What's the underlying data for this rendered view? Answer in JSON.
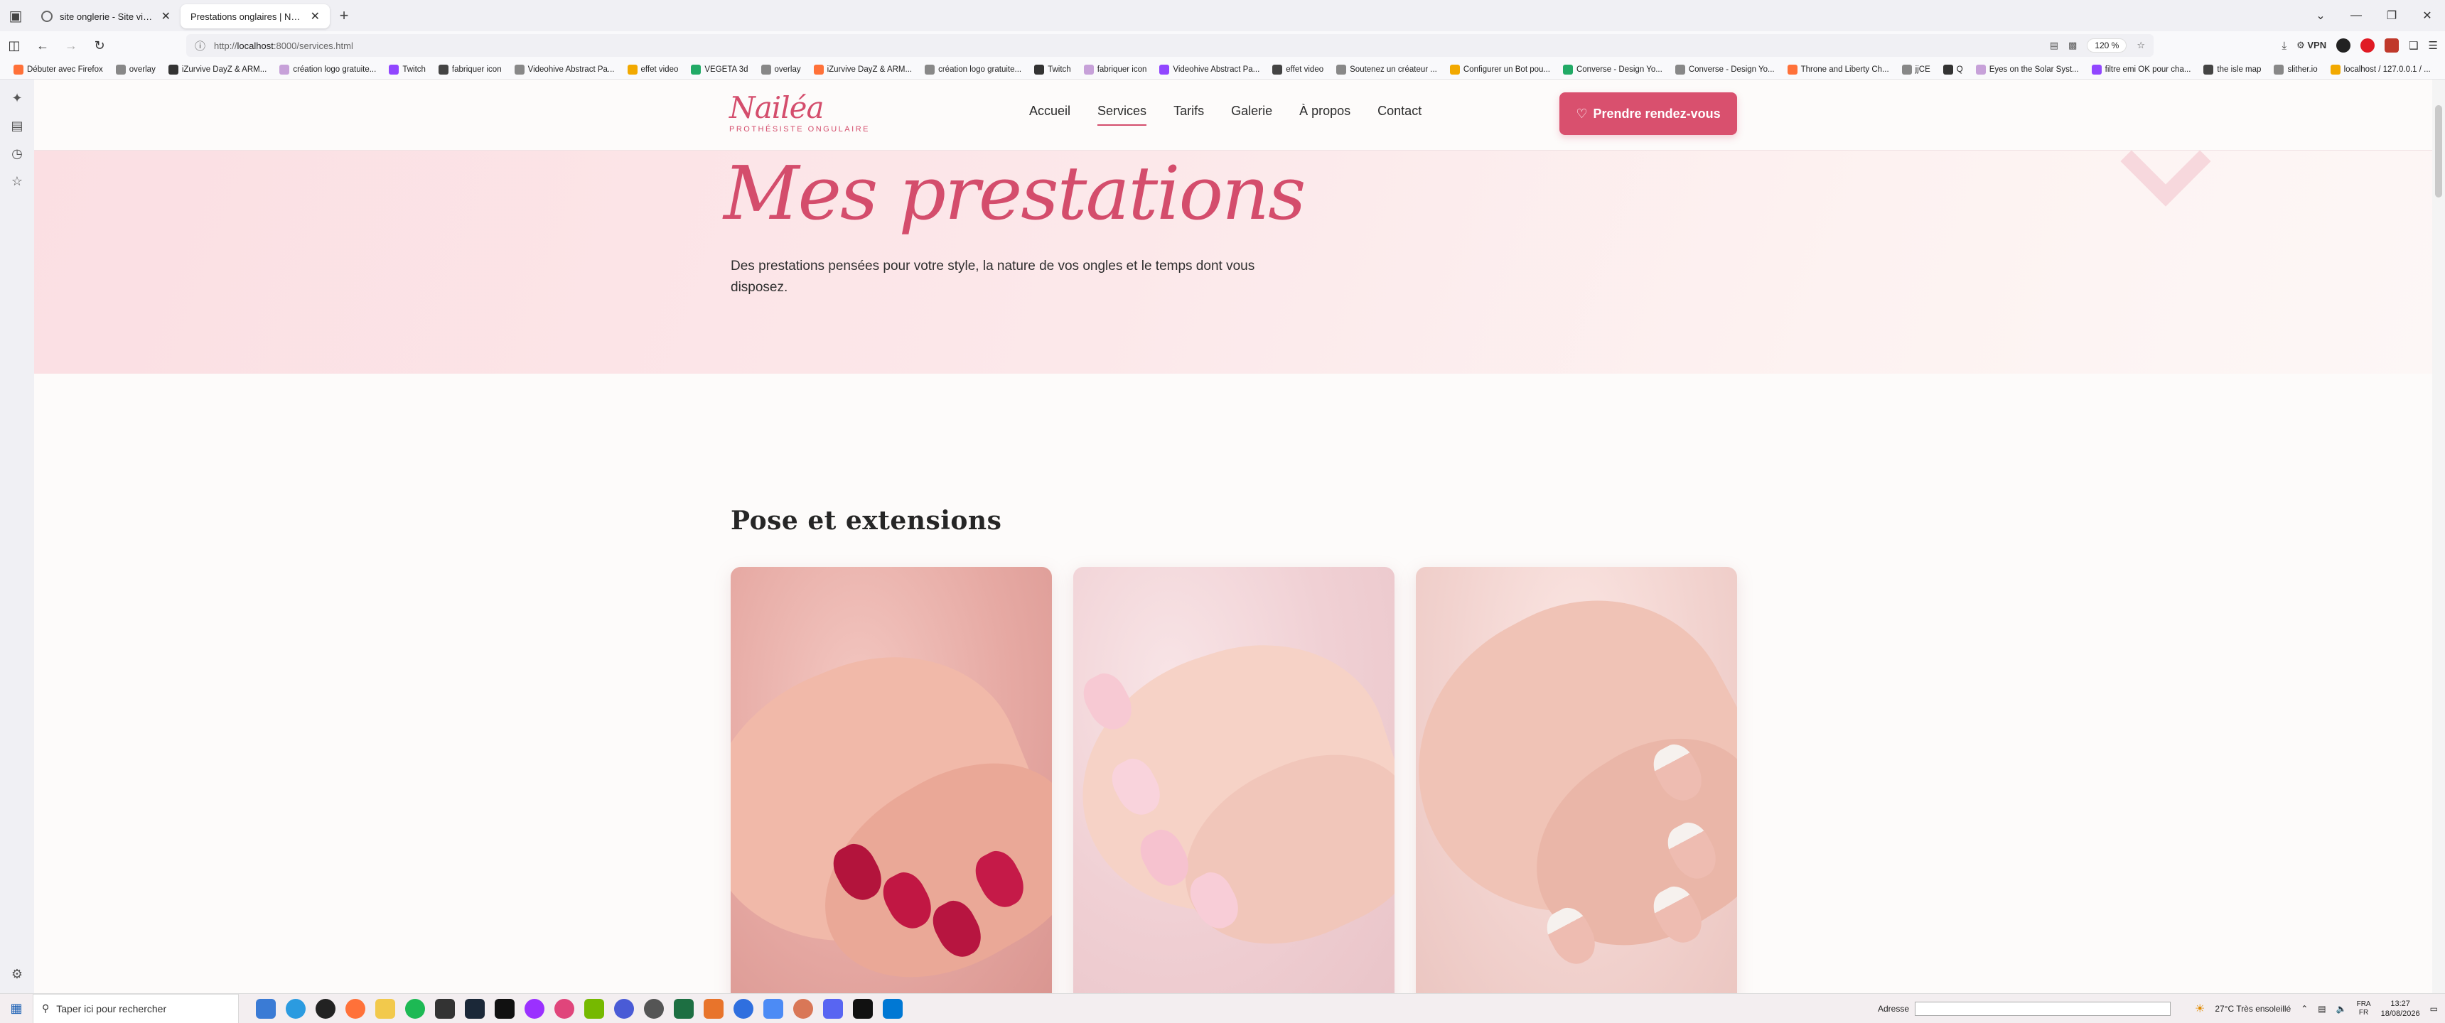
{
  "browser": {
    "tabs": [
      {
        "title": "site onglerie - Site vitrine prothé",
        "active": false
      },
      {
        "title": "Prestations onglaires | Nailéa [Villé",
        "active": true
      }
    ],
    "url_prefix": "http://",
    "url_host": "localhost",
    "url_path": ":8000/services.html",
    "zoom": "120 %",
    "vpn_label": "VPN",
    "bookmarks": [
      "Débuter avec Firefox",
      "overlay",
      "iZurvive DayZ & ARM...",
      "création logo gratuite...",
      "Twitch",
      "fabriquer icon",
      "Videohive Abstract Pa...",
      "effet video",
      "VEGETA 3d",
      "overlay",
      "iZurvive DayZ & ARM...",
      "création logo gratuite...",
      "Twitch",
      "fabriquer icon",
      "Videohive Abstract Pa...",
      "effet video",
      "Soutenez un créateur ...",
      "Configurer un Bot pou...",
      "Converse - Design Yo...",
      "Converse - Design Yo...",
      "Throne and Liberty Ch...",
      "jjCE",
      "Q",
      "Eyes on the Solar Syst...",
      "filtre emi OK pour cha...",
      "the isle map",
      "slither.io",
      "localhost / 127.0.0.1 / ..."
    ]
  },
  "site": {
    "logo_script": "Nailéa",
    "logo_tagline": "PROTHÉSISTE ONGULAIRE",
    "nav": [
      {
        "label": "Accueil",
        "active": false
      },
      {
        "label": "Services",
        "active": true
      },
      {
        "label": "Tarifs",
        "active": false
      },
      {
        "label": "Galerie",
        "active": false
      },
      {
        "label": "À propos",
        "active": false
      },
      {
        "label": "Contact",
        "active": false
      }
    ],
    "cta_icon": "♡",
    "cta_label": "Prendre rendez-vous",
    "hero_title": "Mes prestations",
    "hero_text": "Des prestations pensées pour votre style, la nature de vos ongles et le temps dont vous disposez.",
    "section_title": "Pose et extensions",
    "cards": [
      {
        "icon": "hand-red-nails-photo"
      },
      {
        "icon": "hand-pink-nails-photo"
      },
      {
        "icon": "hand-french-nails-photo"
      }
    ]
  },
  "taskbar": {
    "search_placeholder": "Taper ici pour rechercher",
    "address_label": "Adresse",
    "weather": "27°C  Très ensoleillé",
    "lang_top": "FRA",
    "lang_bottom": "FR",
    "time": "13:27",
    "date": "18/08/2026"
  },
  "colors": {
    "brand": "#d44d6c",
    "cta": "#d9506e",
    "hero_pink": "#fbdfe3"
  }
}
